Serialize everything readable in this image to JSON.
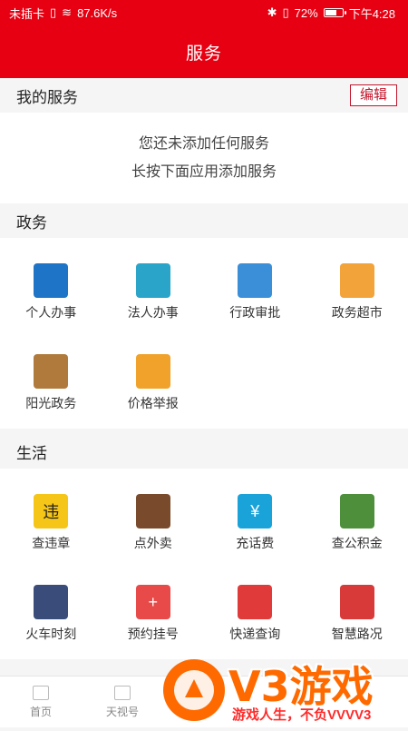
{
  "status_bar": {
    "carrier": "未插卡",
    "speed": "87.6K/s",
    "battery": "72%",
    "battery_level": 0.72,
    "time": "下午4:28"
  },
  "header": {
    "title": "服务"
  },
  "my_services": {
    "title": "我的服务",
    "edit_label": "编辑",
    "empty_line1": "您还未添加任何服务",
    "empty_line2": "长按下面应用添加服务"
  },
  "government": {
    "title": "政务",
    "items": [
      {
        "label": "个人办事",
        "icon": "person-card-icon",
        "color": "#1e74c6"
      },
      {
        "label": "法人办事",
        "icon": "corporate-person-icon",
        "color": "#2aa5c9"
      },
      {
        "label": "行政审批",
        "icon": "calendar-check-icon",
        "color": "#3b8fd8"
      },
      {
        "label": "政务超市",
        "icon": "document-stack-icon",
        "color": "#f2a33a"
      },
      {
        "label": "阳光政务",
        "icon": "gavel-icon",
        "color": "#b07a3c"
      },
      {
        "label": "价格举报",
        "icon": "price-phone-icon",
        "color": "#f0a22a"
      }
    ]
  },
  "life": {
    "title": "生活",
    "items": [
      {
        "label": "查违章",
        "icon": "violation-icon",
        "color": "#f5c518",
        "glyph": "违"
      },
      {
        "label": "点外卖",
        "icon": "food-delivery-icon",
        "color": "#7a4a2c"
      },
      {
        "label": "充话费",
        "icon": "phone-recharge-icon",
        "color": "#1aa3d9",
        "glyph": "¥"
      },
      {
        "label": "查公积金",
        "icon": "housing-fund-icon",
        "color": "#4d8f3a"
      },
      {
        "label": "火车时刻",
        "icon": "train-schedule-icon",
        "color": "#3a4d7a"
      },
      {
        "label": "预约挂号",
        "icon": "medical-kit-icon",
        "color": "#e84a4a",
        "glyph": "+"
      },
      {
        "label": "快递查询",
        "icon": "delivery-truck-icon",
        "color": "#e03a3a"
      },
      {
        "label": "智慧路况",
        "icon": "location-pin-icon",
        "color": "#d83a3a"
      }
    ]
  },
  "bottom_nav": {
    "items": [
      {
        "label": "首页"
      },
      {
        "label": "天视号"
      }
    ]
  },
  "watermark": {
    "brand": "V3游戏",
    "slogan": "游戏人生，不负VVVV3"
  }
}
